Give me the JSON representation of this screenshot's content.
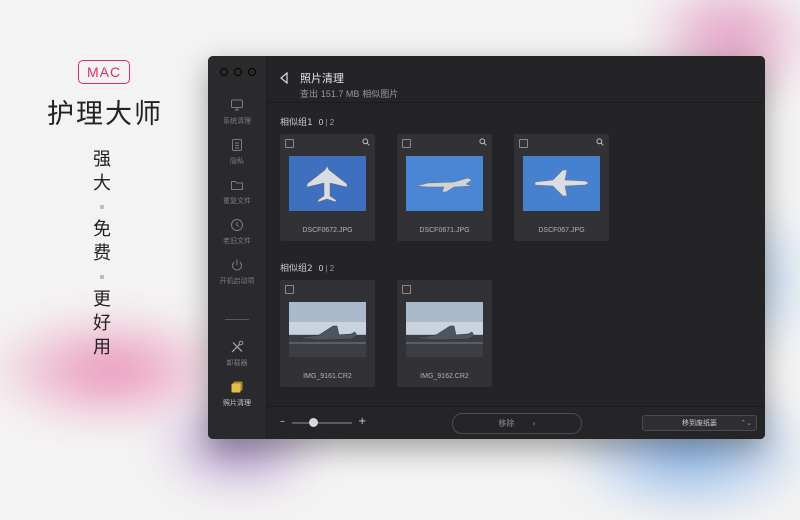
{
  "promo": {
    "badge": "MAC",
    "app_name": "护理大师",
    "tagline": [
      "强",
      "大",
      "免",
      "费",
      "更",
      "好",
      "用"
    ]
  },
  "sidebar": {
    "items": [
      {
        "label": "系统清理",
        "icon": "monitor-icon"
      },
      {
        "label": "隐私",
        "icon": "privacy-icon"
      },
      {
        "label": "重复文件",
        "icon": "folder-icon"
      },
      {
        "label": "老旧文件",
        "icon": "clock-icon"
      },
      {
        "label": "开机启动项",
        "icon": "power-icon"
      },
      {
        "label": "卸载器",
        "icon": "tools-icon"
      },
      {
        "label": "照片清理",
        "icon": "photos-icon"
      }
    ]
  },
  "header": {
    "title": "照片清理",
    "subtitle_prefix": "查出",
    "subtitle_size": "151.7 MB",
    "subtitle_suffix": "相似图片"
  },
  "groups": [
    {
      "label": "相似组1",
      "selected": "0",
      "total": "2",
      "photos": [
        {
          "filename": "DSCF0672.JPG",
          "kind": "jet-top"
        },
        {
          "filename": "DSCF0671.JPG",
          "kind": "jet-side"
        },
        {
          "filename": "DSCF067.JPG",
          "kind": "jet-front"
        }
      ]
    },
    {
      "label": "相似组2",
      "selected": "0",
      "total": "2",
      "photos": [
        {
          "filename": "IMG_9161.CR2",
          "kind": "jet-ground"
        },
        {
          "filename": "IMG_9162.CR2",
          "kind": "jet-ground"
        }
      ]
    }
  ],
  "footer": {
    "zoom_minus": "–",
    "zoom_plus": "+",
    "zoom_level": 0.35,
    "remove_label": "移除",
    "remove_arrow": "›",
    "trash_label": "移到废纸篓",
    "trash_arrows": "⌃⌄"
  },
  "colors": {
    "accent_pink": "#d8306c",
    "window_bg": "#242427",
    "card_bg": "#323236"
  }
}
